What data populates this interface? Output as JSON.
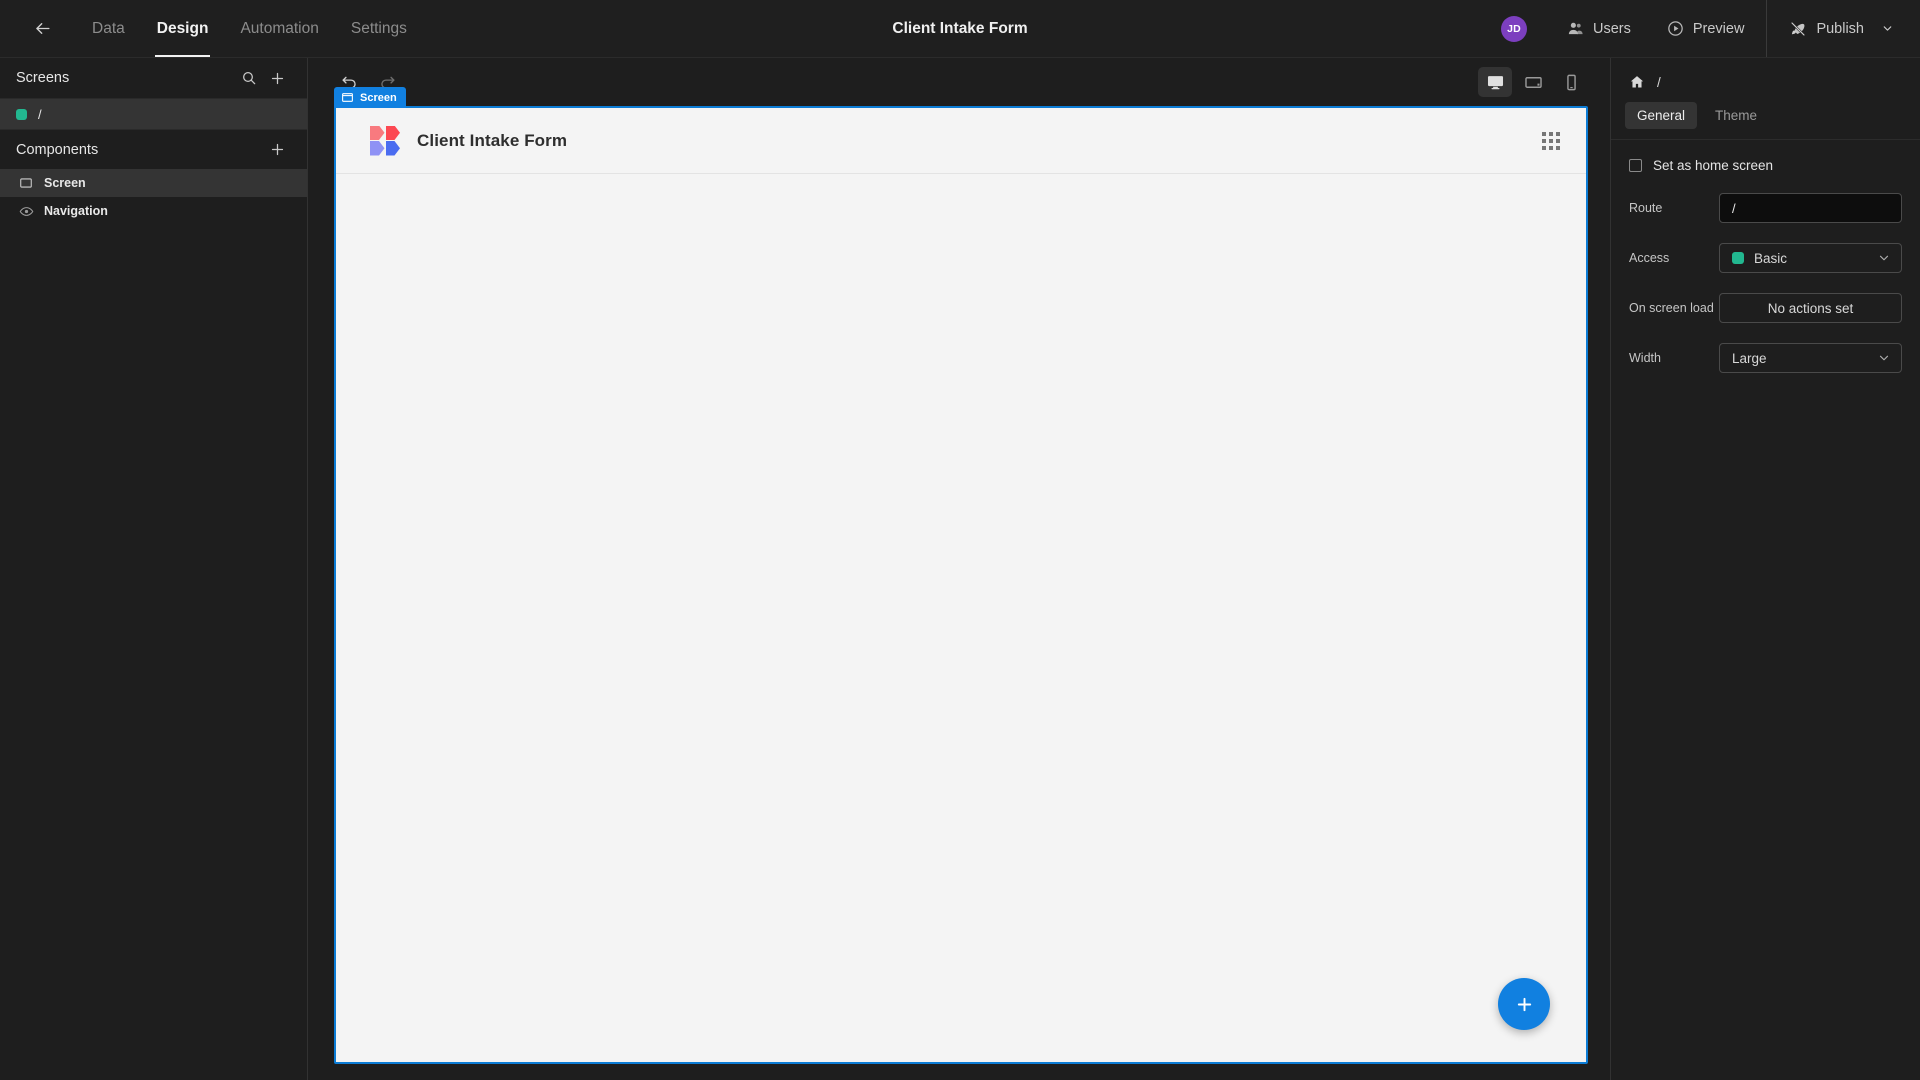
{
  "topbar": {
    "back_icon": "arrow-left-icon",
    "tabs": [
      {
        "label": "Data",
        "active": false
      },
      {
        "label": "Design",
        "active": true
      },
      {
        "label": "Automation",
        "active": false
      },
      {
        "label": "Settings",
        "active": false
      }
    ],
    "title": "Client Intake Form",
    "avatar_initials": "JD",
    "avatar_color": "#7c3fbf",
    "users_label": "Users",
    "preview_label": "Preview",
    "publish_label": "Publish"
  },
  "sidebar": {
    "screens": {
      "title": "Screens",
      "search_icon": "search-icon",
      "add_icon": "plus-icon",
      "items": [
        {
          "label": "/",
          "color": "#22b890",
          "selected": true
        }
      ]
    },
    "components": {
      "title": "Components",
      "add_icon": "plus-icon",
      "items": [
        {
          "label": "Screen",
          "icon": "screen-rect-icon",
          "selected": true
        },
        {
          "label": "Navigation",
          "icon": "eye-icon",
          "selected": false
        }
      ]
    }
  },
  "canvas_toolbar": {
    "undo_icon": "undo-icon",
    "redo_icon": "redo-icon",
    "devices": [
      {
        "name": "desktop-icon",
        "active": true
      },
      {
        "name": "tablet-icon",
        "active": false
      },
      {
        "name": "mobile-icon",
        "active": false
      }
    ]
  },
  "canvas": {
    "badge_label": "Screen",
    "badge_color": "#1180e0",
    "border_color": "#0c7cd5",
    "app_title": "Client Intake Form",
    "logo": {
      "top_left": "#f87a7f",
      "top_right": "#fc4852",
      "bottom_left": "#8f92f5",
      "bottom_right": "#4a6cf0"
    },
    "grip_icon": "grid-dots-icon",
    "fab_icon": "plus-icon",
    "fab_color": "#1180e0"
  },
  "rightpanel": {
    "home_icon": "home-icon",
    "breadcrumb": "/",
    "tabs": [
      {
        "label": "General",
        "active": true
      },
      {
        "label": "Theme",
        "active": false
      }
    ],
    "home_screen_checkbox": {
      "label": "Set as home screen",
      "checked": false
    },
    "fields": [
      {
        "label": "Route",
        "type": "input",
        "value": "/"
      },
      {
        "label": "Access",
        "type": "select",
        "value": "Basic",
        "swatch": "#22b890"
      },
      {
        "label": "On screen load",
        "type": "button",
        "value": "No actions set"
      },
      {
        "label": "Width",
        "type": "select",
        "value": "Large"
      }
    ]
  }
}
